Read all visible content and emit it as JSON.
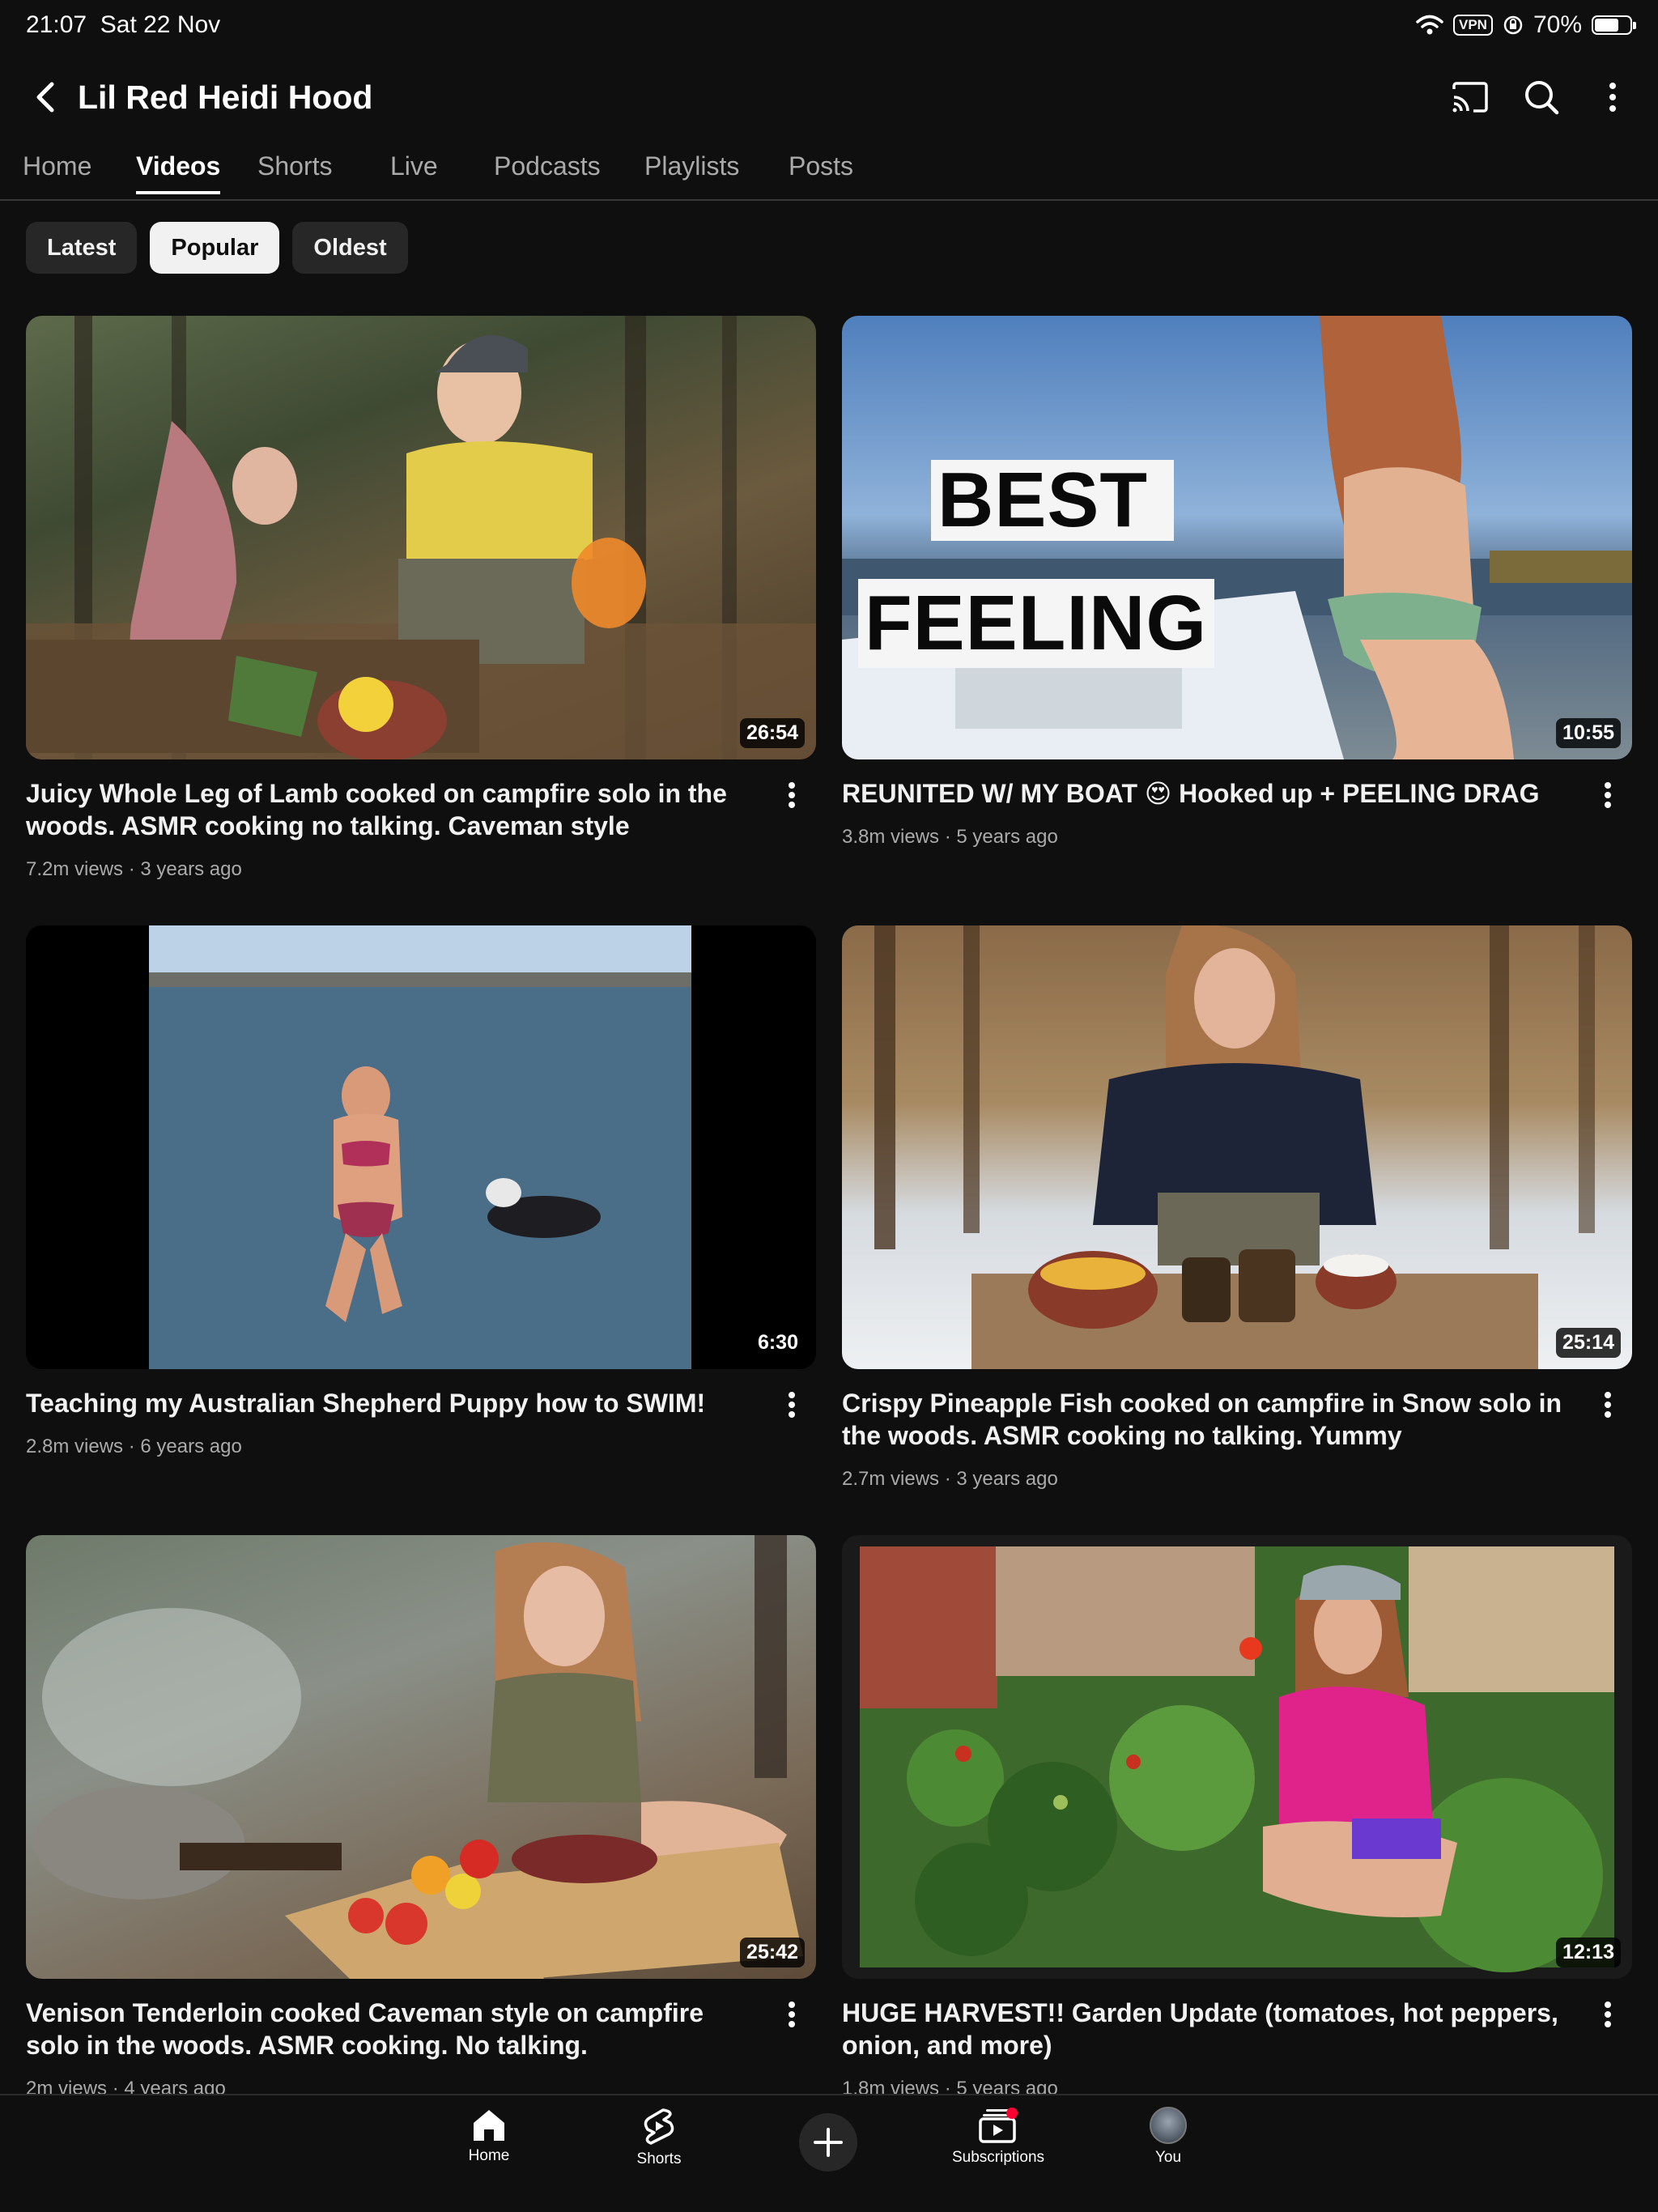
{
  "status_bar": {
    "time": "21:07",
    "date": "Sat 22 Nov",
    "vpn_label": "VPN",
    "battery_text": "70%",
    "battery_level": 0.7
  },
  "header": {
    "title": "Lil Red Heidi Hood",
    "icons": [
      "back-arrow-icon",
      "cast-icon",
      "search-icon",
      "more-vertical-icon"
    ]
  },
  "tabs": [
    {
      "label": "Home"
    },
    {
      "label": "Videos",
      "active": true
    },
    {
      "label": "Shorts"
    },
    {
      "label": "Live"
    },
    {
      "label": "Podcasts"
    },
    {
      "label": "Playlists"
    },
    {
      "label": "Posts"
    }
  ],
  "chips": [
    {
      "label": "Latest"
    },
    {
      "label": "Popular",
      "active": true
    },
    {
      "label": "Oldest"
    }
  ],
  "videos": [
    {
      "title": "Juicy Whole Leg of Lamb cooked on campfire solo in the woods. ASMR cooking no talking. Caveman style",
      "views": "7.2m views",
      "age": "3 years ago",
      "duration": "26:54"
    },
    {
      "title": "REUNITED W/ MY BOAT 😍  Hooked up + PEELING DRAG",
      "views": "3.8m views",
      "age": "5 years ago",
      "duration": "10:55",
      "thumb_text_1": "BEST",
      "thumb_text_2": "FEELING"
    },
    {
      "title": "Teaching my Australian Shepherd Puppy how to SWIM!",
      "views": "2.8m views",
      "age": "6 years ago",
      "duration": "6:30"
    },
    {
      "title": "Crispy Pineapple Fish cooked on campfire in Snow solo in the woods. ASMR cooking no talking. Yummy",
      "views": "2.7m views",
      "age": "3 years ago",
      "duration": "25:14"
    },
    {
      "title": "Venison Tenderloin cooked Caveman style on campfire solo in the woods. ASMR cooking. No talking.",
      "views": "2m views",
      "age": "4 years ago",
      "duration": "25:42"
    },
    {
      "title": "HUGE HARVEST!! Garden Update (tomatoes, hot peppers, onion, and more)",
      "views": "1.8m views",
      "age": "5 years ago",
      "duration": "12:13"
    }
  ],
  "meta_separator": "·",
  "bottom_nav": [
    {
      "label": "Home",
      "icon": "home-icon"
    },
    {
      "label": "Shorts",
      "icon": "shorts-icon"
    },
    {
      "label": "",
      "icon": "create-plus-icon"
    },
    {
      "label": "Subscriptions",
      "icon": "subscriptions-icon"
    },
    {
      "label": "You",
      "icon": "avatar"
    }
  ]
}
